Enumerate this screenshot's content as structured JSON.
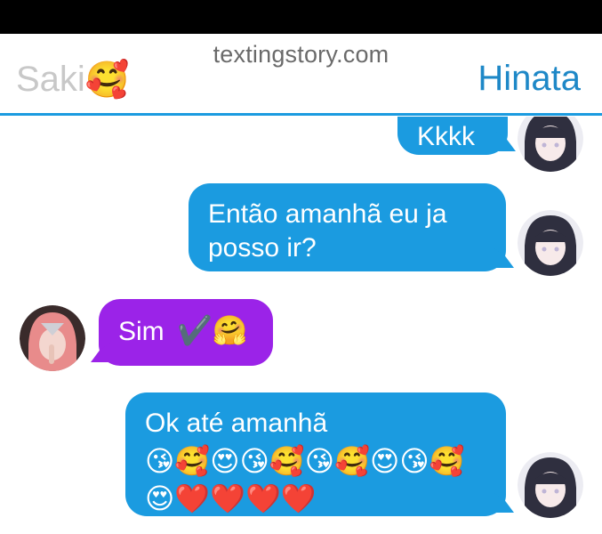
{
  "header": {
    "watermark": "textingstory.com",
    "left_name": "Saki",
    "left_emoji": "🥰",
    "right_name": "Hinata"
  },
  "messages": [
    {
      "side": "right",
      "text": "Kkkk"
    },
    {
      "side": "right",
      "text": "Então amanhã eu ja posso ir?"
    },
    {
      "side": "left",
      "text": "Sim",
      "emojis": "✔️🤗"
    },
    {
      "side": "right",
      "text": "Ok até amanhã",
      "emojis": "😘🥰😍😘🥰😘🥰😍😘🥰😍❤️❤️❤️❤️"
    }
  ],
  "colors": {
    "sent_bubble": "#1b9be0",
    "received_bubble": "#9b23e8",
    "header_rule": "#1b9be0",
    "left_name": "#c8c8c8",
    "right_name": "#1e88c7"
  }
}
